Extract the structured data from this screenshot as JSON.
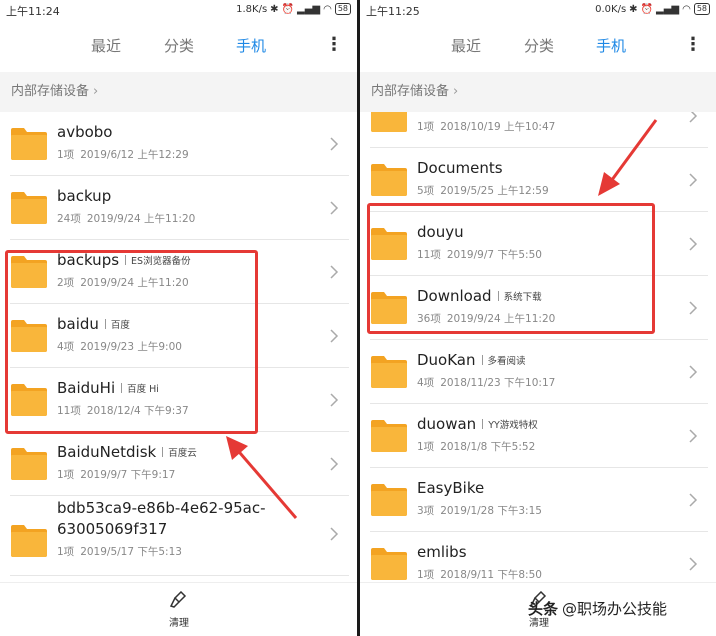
{
  "left": {
    "status": {
      "time": "上午11:24",
      "speed": "1.8K/s",
      "battery": "58"
    },
    "tabs": [
      "最近",
      "分类",
      "手机"
    ],
    "breadcrumb": "内部存储设备",
    "rows": [
      {
        "name": "avbobo",
        "tag": "",
        "count": "1项",
        "date": "2019/6/12 上午12:29"
      },
      {
        "name": "backup",
        "tag": "",
        "count": "24项",
        "date": "2019/9/24 上午11:20"
      },
      {
        "name": "backups",
        "tag": "ES浏览器备份",
        "count": "2项",
        "date": "2019/9/24 上午11:20"
      },
      {
        "name": "baidu",
        "tag": "百度",
        "count": "4项",
        "date": "2019/9/23 上午9:00"
      },
      {
        "name": "BaiduHi",
        "tag": "百度 Hi",
        "count": "11项",
        "date": "2018/12/4 下午9:37"
      },
      {
        "name": "BaiduNetdisk",
        "tag": "百度云",
        "count": "1项",
        "date": "2019/9/7 下午9:17"
      },
      {
        "name": "bdb53ca9-e86b-4e62-95ac-",
        "name2": "63005069f317",
        "tag": "",
        "count": "1项",
        "date": "2019/5/17 下午5:13"
      }
    ],
    "clean_label": "清理"
  },
  "right": {
    "status": {
      "time": "上午11:25",
      "speed": "0.0K/s",
      "battery": "58"
    },
    "tabs": [
      "最近",
      "分类",
      "手机"
    ],
    "breadcrumb": "内部存储设备",
    "partial_row": {
      "count": "1项",
      "date": "2018/10/19 上午10:47"
    },
    "rows": [
      {
        "name": "Documents",
        "tag": "",
        "count": "5项",
        "date": "2019/5/25 上午12:59"
      },
      {
        "name": "douyu",
        "tag": "",
        "count": "11项",
        "date": "2019/9/7 下午5:50"
      },
      {
        "name": "Download",
        "tag": "系统下载",
        "count": "36项",
        "date": "2019/9/24 上午11:20"
      },
      {
        "name": "DuoKan",
        "tag": "多看阅读",
        "count": "4项",
        "date": "2018/11/23 下午10:17"
      },
      {
        "name": "duowan",
        "tag": "YY游戏特权",
        "count": "1项",
        "date": "2018/1/8 下午5:52"
      },
      {
        "name": "EasyBike",
        "tag": "",
        "count": "3项",
        "date": "2019/1/28 下午3:15"
      },
      {
        "name": "emlibs",
        "tag": "",
        "count": "1项",
        "date": "2018/9/11 下午8:50"
      }
    ],
    "clean_label": "清理"
  },
  "watermark": {
    "logo": "头条",
    "text": "@职场办公技能"
  },
  "colors": {
    "accent": "#1e88e5",
    "folder": "#f9b63b",
    "folder_tab": "#f3a322",
    "highlight": "#e53935"
  }
}
